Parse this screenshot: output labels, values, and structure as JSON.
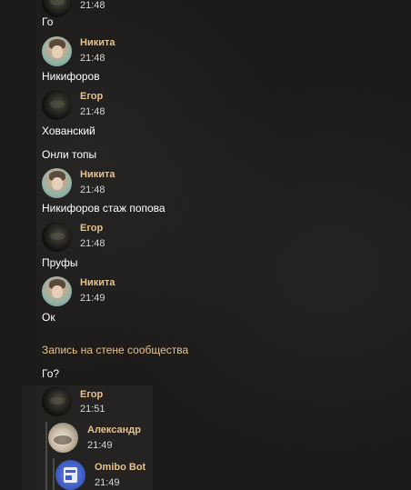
{
  "messages": [
    {
      "type": "text",
      "text": "Го"
    },
    {
      "type": "message",
      "author": "Никита",
      "time": "21:48",
      "text": "Никифоров"
    },
    {
      "type": "message",
      "author": "Егор",
      "time": "21:48",
      "text": "Хованский"
    },
    {
      "type": "text",
      "text": "Онли топы"
    },
    {
      "type": "message",
      "author": "Никита",
      "time": "21:48",
      "text": "Никифоров стаж попова"
    },
    {
      "type": "message",
      "author": "Егор",
      "time": "21:48",
      "text": "Пруфы"
    },
    {
      "type": "message",
      "author": "Никита",
      "time": "21:49",
      "text": "Ок"
    },
    {
      "type": "wall_post_link",
      "text": "Запись на стене сообщества"
    },
    {
      "type": "text",
      "text": "Го?"
    },
    {
      "type": "message",
      "author": "Егор",
      "time": "21:51"
    }
  ],
  "top_partial_time": "21:48",
  "forwarded": [
    {
      "author": "Александр",
      "time": "21:49"
    },
    {
      "author": "Omibo Bot",
      "time": "21:49"
    }
  ],
  "colors": {
    "author_name": "#e9c28a",
    "background": "#1c1b1a",
    "text": "#ffffff",
    "timestamp": "#d7d7d7"
  }
}
